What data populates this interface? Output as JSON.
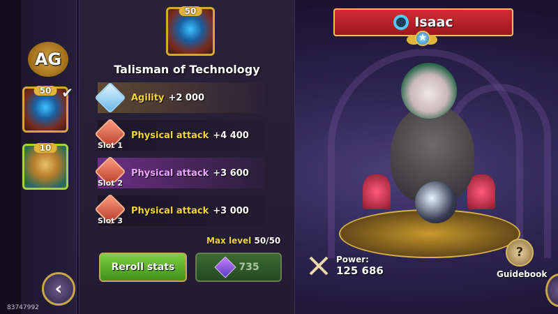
{
  "item": {
    "title": "Talisman of Technology",
    "level": "50"
  },
  "sidebar": {
    "logo_text": "AG",
    "items": [
      {
        "level": "50",
        "selected": true
      },
      {
        "level": "10",
        "selected": false
      }
    ]
  },
  "stats": [
    {
      "name": "Agility",
      "value": "+2 000",
      "slot": ""
    },
    {
      "name": "Physical attack",
      "value": "+4 400",
      "slot": "Slot 1"
    },
    {
      "name": "Physical attack",
      "value": "+3 600",
      "slot": "Slot 2"
    },
    {
      "name": "Physical attack",
      "value": "+3 000",
      "slot": "Slot 3"
    }
  ],
  "max_level": {
    "label": "Max level",
    "value": "50/50"
  },
  "buttons": {
    "reroll": "Reroll stats",
    "cost": "735",
    "guidebook": "Guidebook"
  },
  "hero": {
    "name": "Isaac",
    "power_label": "Power:",
    "power_value": "125 686"
  },
  "user_id": "83747992",
  "colors": {
    "banner": "#c4222b",
    "reroll_button": "#5fb12e",
    "stat_label": "#f3d43a",
    "slot2_label": "#e9a7ff"
  }
}
